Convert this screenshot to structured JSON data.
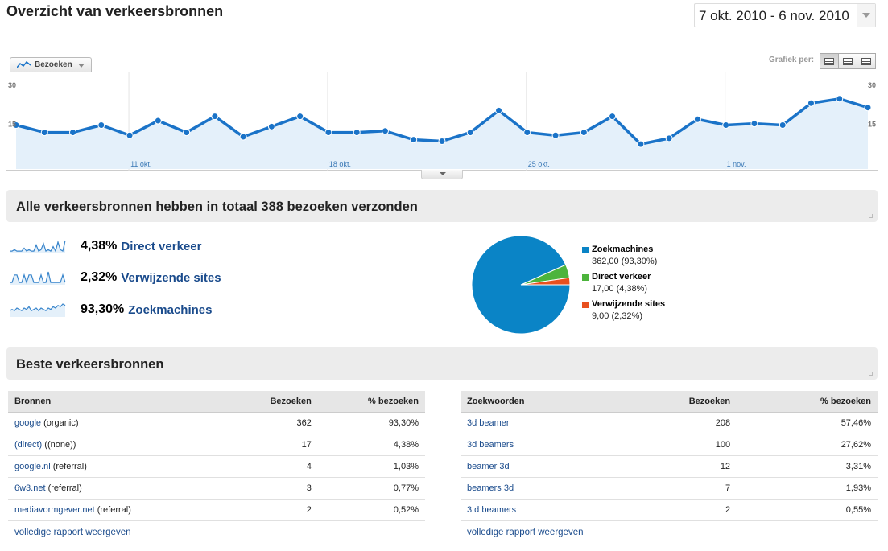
{
  "header": {
    "title": "Overzicht van verkeersbronnen",
    "date_range": "7 okt. 2010 - 6 nov. 2010"
  },
  "chart_controls": {
    "metric": "Bezoeken",
    "grafiek_label": "Grafiek per:"
  },
  "chart_data": {
    "type": "area",
    "series": [
      {
        "name": "Bezoeken",
        "values": [
          15,
          12.5,
          12.5,
          15,
          11.5,
          16.5,
          12.5,
          18,
          11,
          14.5,
          18,
          12.5,
          12.5,
          13,
          10,
          9.5,
          12.5,
          20,
          12.5,
          11.5,
          12.5,
          18,
          8.5,
          10.5,
          17,
          15,
          15.5,
          15,
          22.5,
          24,
          21
        ]
      }
    ],
    "x_tick_labels": [
      "11 okt.",
      "18 okt.",
      "25 okt.",
      "1 nov."
    ],
    "y_tick_left": [
      "30",
      "15"
    ],
    "y_tick_right": [
      "30",
      "15"
    ],
    "ylim": [
      0,
      30
    ],
    "color": "#1a73c8",
    "fill_color": "#e4f0fa"
  },
  "summary": {
    "title": "Alle verkeersbronnen hebben in totaal 388 bezoeken verzonden",
    "sources": [
      {
        "pct": "4,38%",
        "name": "Direct verkeer",
        "spark": [
          1,
          1,
          2,
          1,
          1,
          1,
          3,
          1,
          2,
          1,
          1,
          5,
          1,
          2,
          6,
          1,
          2,
          1,
          4,
          1,
          7,
          2,
          1,
          8
        ]
      },
      {
        "pct": "2,32%",
        "name": "Verwijzende sites",
        "spark": [
          1,
          1,
          6,
          6,
          1,
          1,
          6,
          1,
          6,
          6,
          1,
          1,
          1,
          6,
          1,
          1,
          8,
          1,
          1,
          1,
          1,
          1,
          6,
          1
        ]
      },
      {
        "pct": "93,30%",
        "name": "Zoekmachines",
        "spark": [
          4,
          5,
          4,
          6,
          5,
          4,
          6,
          5,
          7,
          4,
          5,
          6,
          4,
          6,
          5,
          4,
          6,
          5,
          7,
          6,
          8,
          7,
          9,
          8
        ]
      }
    ]
  },
  "pie_data": {
    "type": "pie",
    "slices": [
      {
        "name": "Zoekmachines",
        "label": "362,00 (93,30%)",
        "value": 362,
        "color": "#0a84c6"
      },
      {
        "name": "Direct verkeer",
        "label": "17,00 (4,38%)",
        "value": 17,
        "color": "#4cb43c"
      },
      {
        "name": "Verwijzende sites",
        "label": "9,00 (2,32%)",
        "value": 9,
        "color": "#e8501f"
      }
    ]
  },
  "best_sources": {
    "title": "Beste verkeersbronnen",
    "sources_table": {
      "headers": [
        "Bronnen",
        "Bezoeken",
        "% bezoeken"
      ],
      "rows": [
        {
          "link": "google",
          "suffix": " (organic)",
          "visits": "362",
          "pct": "93,30%"
        },
        {
          "link": "(direct)",
          "suffix": " ((none))",
          "visits": "17",
          "pct": "4,38%"
        },
        {
          "link": "google.nl",
          "suffix": " (referral)",
          "visits": "4",
          "pct": "1,03%"
        },
        {
          "link": "6w3.net",
          "suffix": " (referral)",
          "visits": "3",
          "pct": "0,77%"
        },
        {
          "link": "mediavormgever.net",
          "suffix": " (referral)",
          "visits": "2",
          "pct": "0,52%"
        }
      ],
      "full_report": "volledige rapport weergeven"
    },
    "keywords_table": {
      "headers": [
        "Zoekwoorden",
        "Bezoeken",
        "% bezoeken"
      ],
      "rows": [
        {
          "link": "3d beamer",
          "visits": "208",
          "pct": "57,46%"
        },
        {
          "link": "3d beamers",
          "visits": "100",
          "pct": "27,62%"
        },
        {
          "link": "beamer 3d",
          "visits": "12",
          "pct": "3,31%"
        },
        {
          "link": "beamers 3d",
          "visits": "7",
          "pct": "1,93%"
        },
        {
          "link": "3 d beamers",
          "visits": "2",
          "pct": "0,55%"
        }
      ],
      "full_report": "volledige rapport weergeven"
    }
  }
}
